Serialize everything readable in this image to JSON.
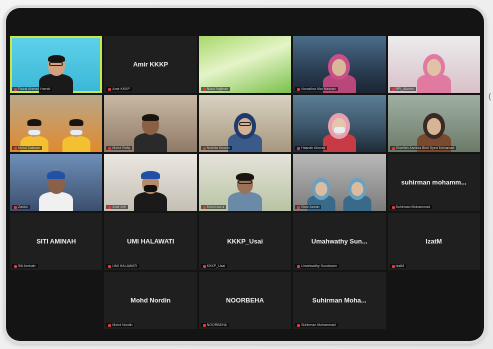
{
  "meeting": {
    "right_edge_glyph": "("
  },
  "tiles": [
    {
      "name": "",
      "label": "Faizal Ahmad Hamid",
      "type": "video",
      "bg": "v-cyan",
      "active": true
    },
    {
      "name": "Amir KKKP",
      "label": "Amir KKKP",
      "type": "name"
    },
    {
      "name": "",
      "label": "Nurul Najihah",
      "type": "video",
      "bg": "v-green"
    },
    {
      "name": "",
      "label": "Norazlina Mat Hassan",
      "type": "video",
      "bg": "v-office"
    },
    {
      "name": "",
      "label": "BPI_Alumni",
      "type": "video",
      "bg": "v-pink"
    },
    {
      "name": "",
      "label": "Mohd Zakwan",
      "type": "video",
      "bg": "v-orange"
    },
    {
      "name": "",
      "label": "Mohd Rafiq",
      "type": "video",
      "bg": "v-room"
    },
    {
      "name": "",
      "label": "Norlida Hussin",
      "type": "video",
      "bg": "v-wall"
    },
    {
      "name": "",
      "label": "Hasnah Ahmad",
      "type": "video",
      "bg": "v-office2"
    },
    {
      "name": "",
      "label": "Sharifah Asmida Binti Syed Mohamad",
      "type": "video",
      "bg": "v-hijab"
    },
    {
      "name": "",
      "label": "Zaidul",
      "type": "video",
      "bg": "v-blue"
    },
    {
      "name": "",
      "label": "Amir Arif",
      "type": "video",
      "bg": "v-light"
    },
    {
      "name": "",
      "label": "Mohd Azrul",
      "type": "video",
      "bg": "v-plant"
    },
    {
      "name": "",
      "label": "Noor Azean",
      "type": "video",
      "bg": "v-gray"
    },
    {
      "name": "suhirman mohamm...",
      "label": "Suhirman Mohammad",
      "type": "name"
    },
    {
      "name": "SITI AMINAH",
      "label": "Siti Aminah",
      "type": "name"
    },
    {
      "name": "UMI HALAWATI",
      "label": "UMI HALAWATI",
      "type": "name"
    },
    {
      "name": "KKKP_Usai",
      "label": "KKKP_Usai",
      "type": "name"
    },
    {
      "name": "Umahwathy Sun...",
      "label": "Umahwathy Sundaram",
      "type": "name"
    },
    {
      "name": "IzatM",
      "label": "IzatM",
      "type": "name"
    },
    {
      "name": "",
      "label": "",
      "type": "empty"
    },
    {
      "name": "Mohd Nordin",
      "label": "Mohd Nordin",
      "type": "name"
    },
    {
      "name": "NOORBEHA",
      "label": "NOORBEHA",
      "type": "name"
    },
    {
      "name": "Suhirman Moha...",
      "label": "Suhirman Mohammad",
      "type": "name"
    },
    {
      "name": "",
      "label": "",
      "type": "empty"
    }
  ]
}
